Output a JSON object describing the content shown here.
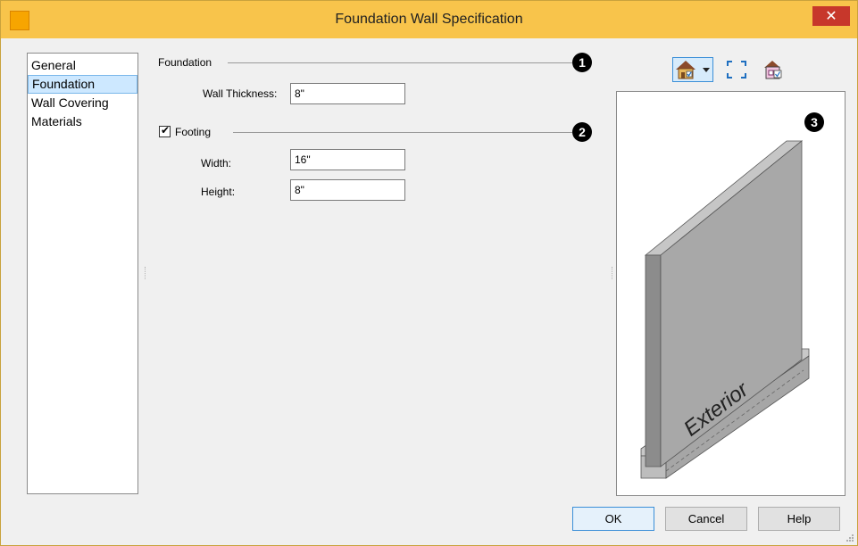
{
  "window": {
    "title": "Foundation Wall Specification",
    "close_glyph": "✕"
  },
  "nav": {
    "items": [
      {
        "label": "General"
      },
      {
        "label": "Foundation"
      },
      {
        "label": "Wall Covering"
      },
      {
        "label": "Materials"
      }
    ],
    "selected": "Foundation"
  },
  "foundation_group": {
    "label": "Foundation",
    "callout": "1",
    "wall_thickness_label": "Wall Thickness:",
    "wall_thickness_value": "8\""
  },
  "footing_group": {
    "label": "Footing",
    "checked": true,
    "check_glyph": "✔",
    "callout": "2",
    "width_label": "Width:",
    "width_value": "16\"",
    "height_label": "Height:",
    "height_value": "8\""
  },
  "preview": {
    "callout": "3",
    "caption": "Exterior",
    "toolbar_icons": [
      "house-view-dropdown-icon",
      "fill-window-icon",
      "display-options-icon"
    ]
  },
  "buttons": {
    "ok": "OK",
    "cancel": "Cancel",
    "help": "Help"
  },
  "colors": {
    "titlebar": "#f8c44b",
    "close": "#c7372b",
    "selection": "#cde8ff",
    "wall_front": "#a8a8a8",
    "wall_side": "#8c8c8c",
    "wall_top": "#c6c6c6"
  }
}
